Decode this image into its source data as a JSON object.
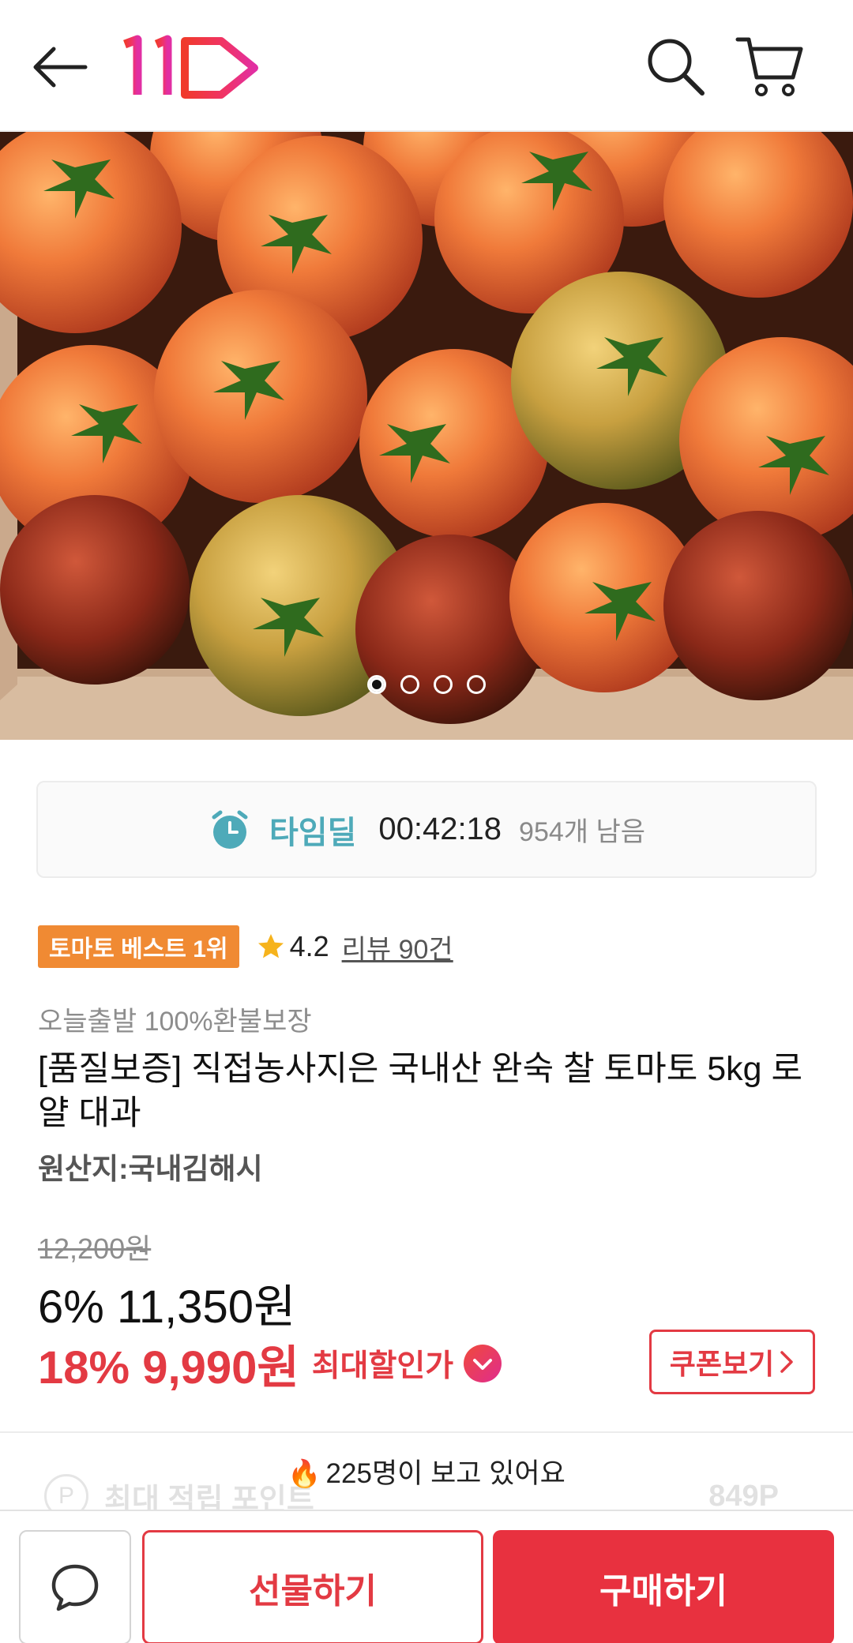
{
  "header": {
    "back_icon": "arrow-left-icon",
    "logo_text": "11",
    "search_icon": "search-icon",
    "cart_icon": "cart-icon"
  },
  "gallery": {
    "image_count": 4,
    "active_index": 0
  },
  "timedeal": {
    "icon": "alarm-clock-icon",
    "label": "타임딜",
    "countdown": "00:42:18",
    "remaining": "954개 남음"
  },
  "product": {
    "best_badge": "토마토 베스트 1위",
    "rating": "4.2",
    "review_link": "리뷰 90건",
    "promo_text": "오늘출발 100%환불보장",
    "title": "[품질보증] 직접농사지은 국내산 완숙 찰 토마토 5kg 로얄 대과",
    "origin": "원산지:국내김해시"
  },
  "price": {
    "original": "12,200원",
    "sale": "6% 11,350원",
    "max_discount": "18% 9,990원",
    "max_label": "최대할인가",
    "coupon_label": "쿠폰보기"
  },
  "social": {
    "viewers": "225명이 보고 있어요"
  },
  "points": {
    "icon_letter": "P",
    "label": "최대 적립 포인트",
    "value": "849P"
  },
  "bottom_bar": {
    "chat_icon": "chat-bubble-icon",
    "gift_label": "선물하기",
    "buy_label": "구매하기"
  },
  "colors": {
    "accent_red": "#e33a43",
    "timedeal_teal": "#4eaab9",
    "badge_orange": "#f08a33"
  }
}
